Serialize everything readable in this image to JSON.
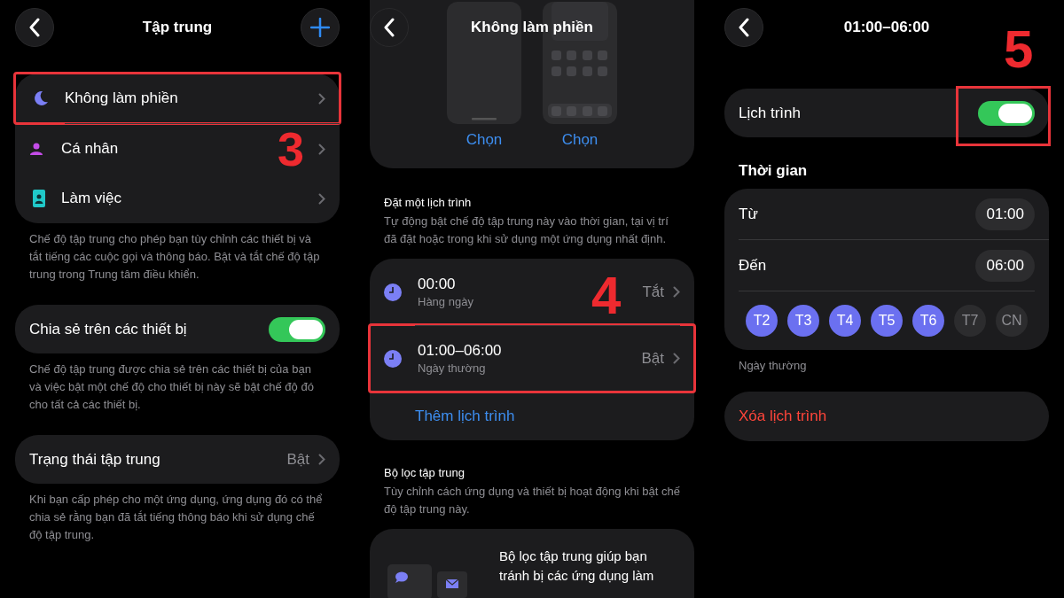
{
  "focus_screen": {
    "title": "Tập trung",
    "modes": [
      {
        "label": "Không làm phiền",
        "kind": "sleep",
        "highlighted": true
      },
      {
        "label": "Cá nhân",
        "kind": "personal",
        "highlighted": false,
        "step_marker": "3"
      },
      {
        "label": "Làm việc",
        "kind": "work",
        "highlighted": false
      }
    ],
    "modes_note": "Chế độ tập trung cho phép bạn tùy chỉnh các thiết bị và tắt tiếng các cuộc gọi và thông báo. Bật và tắt chế độ tập trung trong Trung tâm điều khiển.",
    "share_toggle": {
      "label": "Chia sẻ trên các thiết bị",
      "on": true
    },
    "share_note": "Chế độ tập trung được chia sẻ trên các thiết bị của bạn và việc bật một chế độ cho thiết bị này sẽ bật chế độ đó cho tất cả các thiết bị.",
    "status_row": {
      "label": "Trạng thái tập trung",
      "value": "Bật"
    },
    "status_note": "Khi bạn cấp phép cho một ứng dụng, ứng dụng đó có thể chia sẻ rằng bạn đã tắt tiếng thông báo khi sử dụng chế độ tập trung."
  },
  "dnd_screen": {
    "title": "Không làm phiền",
    "previews": [
      {
        "label": "Chọn",
        "kind": "lock"
      },
      {
        "label": "Chọn",
        "kind": "home"
      }
    ],
    "schedule_heading": "Đặt một lịch trình",
    "schedule_note": "Tự động bật chế độ tập trung này vào thời gian, tại vị trí đã đặt hoặc trong khi sử dụng một ứng dụng nhất định.",
    "schedules": [
      {
        "time": "00:00",
        "repeat": "Hàng ngày",
        "status": "Tắt",
        "highlighted": false,
        "step_marker": "4"
      },
      {
        "time": "01:00–06:00",
        "repeat": "Ngày thường",
        "status": "Bật",
        "highlighted": true
      }
    ],
    "add_schedule": "Thêm lịch trình",
    "filter_heading": "Bộ lọc tập trung",
    "filter_note": "Tùy chỉnh cách ứng dụng và thiết bị hoạt động khi bật chế độ tập trung này.",
    "filter_card_lines": [
      "Bộ lọc tập trung giúp bạn",
      "tránh bị các ứng dụng làm"
    ]
  },
  "schedule_screen": {
    "title": "01:00–06:00",
    "schedule_toggle": {
      "label": "Lịch trình",
      "on": true,
      "highlighted": true
    },
    "time_heading": "Thời gian",
    "times": [
      {
        "label": "Từ",
        "value": "01:00"
      },
      {
        "label": "Đến",
        "value": "06:00"
      }
    ],
    "days": [
      {
        "label": "T2",
        "selected": true
      },
      {
        "label": "T3",
        "selected": true
      },
      {
        "label": "T4",
        "selected": true
      },
      {
        "label": "T5",
        "selected": true
      },
      {
        "label": "T6",
        "selected": true
      },
      {
        "label": "T7",
        "selected": false
      },
      {
        "label": "CN",
        "selected": false
      }
    ],
    "days_caption": "Ngày thường",
    "delete_button": "Xóa lịch trình",
    "step_marker": "5"
  }
}
